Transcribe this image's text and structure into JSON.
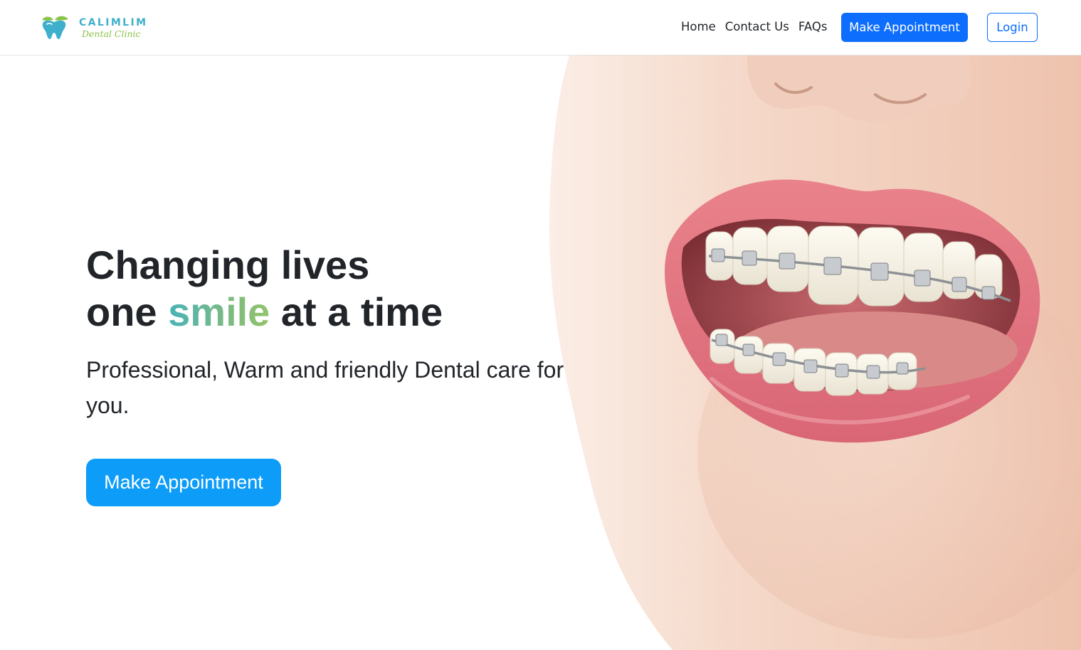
{
  "brand": {
    "name": "CALIMLIM",
    "subtitle": "Dental Clinic",
    "logo_icon": "tooth-leaf-icon",
    "colors": {
      "name": "#3fb0cc",
      "subtitle": "#8bbf4a"
    }
  },
  "nav": {
    "links": [
      "Home",
      "Contact Us",
      "FAQs"
    ],
    "appointment_label": "Make Appointment",
    "login_label": "Login",
    "colors": {
      "primary": "#0d6efd"
    }
  },
  "hero": {
    "title_line1": "Changing lives",
    "title_line2_pre": "one ",
    "title_highlight": "smile",
    "title_line2_post": " at a time",
    "subtitle": "Professional, Warm and friendly Dental care for you.",
    "cta_label": "Make Appointment",
    "image_icon": "smiling-mouth-braces-photo",
    "colors": {
      "cta": "#0d9cf8",
      "highlight_start": "#48b3b8",
      "highlight_end": "#93c46b",
      "text": "#212529"
    }
  }
}
